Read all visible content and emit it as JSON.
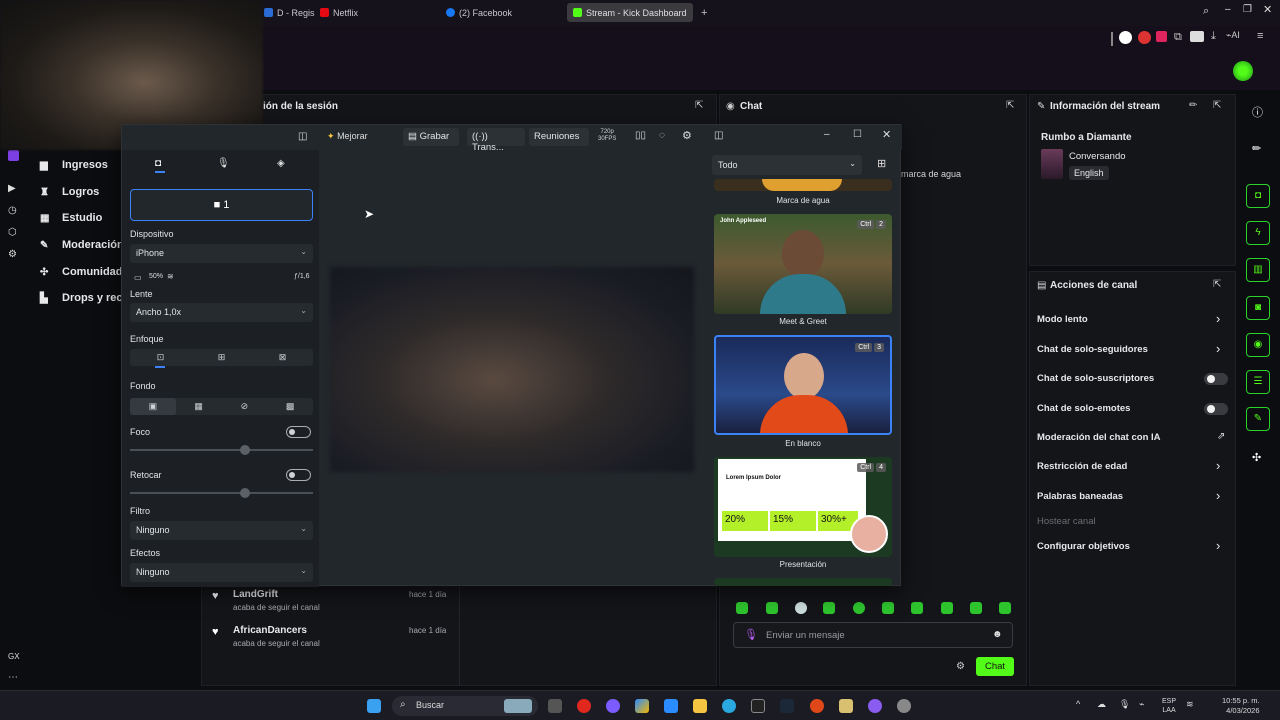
{
  "browser": {
    "tabs": [
      {
        "label": "D - Regis",
        "color": "#2b6bd6"
      },
      {
        "label": "Netflix",
        "color": "#e50914"
      },
      {
        "label": "(2) Facebook",
        "color": "#1877f2"
      },
      {
        "label": "Stream - Kick Dashboard",
        "color": "#53fc18"
      }
    ],
    "new_tab": "+",
    "ai_label": "AI"
  },
  "session_panel": {
    "title": "ión de la sesión"
  },
  "chat_panel": {
    "title": "Chat",
    "watermark_text": "marca de agua",
    "input_placeholder": "Enviar un mensaje",
    "send_label": "Chat"
  },
  "sidebar": {
    "items": [
      {
        "label": "Ingresos",
        "icon": "chart-icon"
      },
      {
        "label": "Logros",
        "icon": "trophy-icon"
      },
      {
        "label": "Estudio",
        "icon": "studio-icon"
      },
      {
        "label": "Moderación",
        "icon": "wrench-icon"
      },
      {
        "label": "Comunidad",
        "icon": "community-icon"
      },
      {
        "label": "Drops y rec",
        "icon": "drops-icon"
      }
    ],
    "gx_label": "GX"
  },
  "activity": [
    {
      "user": "LandGrift",
      "text": "acaba de seguir el canal",
      "time": "hace 1 día"
    },
    {
      "user": "AfricanDancers",
      "text": "acaba de seguir el canal",
      "time": "hace 1 día"
    }
  ],
  "camera_app": {
    "toolbar": {
      "enhance": "Mejorar",
      "record": "Grabar",
      "transmit": "Trans...",
      "meetings": "Reuniones",
      "res_top": "720p",
      "res_bottom": "30FPS"
    },
    "camera_button": "1",
    "device_label": "Dispositivo",
    "device_value": "iPhone",
    "battery": "50%",
    "aperture": "ƒ/1,6",
    "lens_label": "Lente",
    "lens_value": "Ancho 1,0x",
    "focus_label": "Enfoque",
    "background_label": "Fondo",
    "blur_label": "Foco",
    "retouch_label": "Retocar",
    "filter_label": "Filtro",
    "filter_value": "Ninguno",
    "effects_label": "Efectos",
    "effects_value": "Ninguno",
    "scene_filter": "Todo",
    "scenes": [
      {
        "caption": "Marca de agua"
      },
      {
        "caption": "Meet & Greet",
        "key": "Ctrl",
        "num": "2",
        "card_name": "John Appleseed"
      },
      {
        "caption": "En blanco",
        "key": "Ctrl",
        "num": "3"
      },
      {
        "caption": "Presentación",
        "key": "Ctrl",
        "num": "4",
        "slide_title": "Lorem Ipsum Dolor",
        "stats": [
          "20%",
          "15%",
          "30%+"
        ]
      }
    ]
  },
  "stream_info": {
    "title": "Información del stream",
    "stream_title": "Rumbo a Diamante",
    "category": "Conversando",
    "language": "English"
  },
  "channel_actions": {
    "title": "Acciones de canal",
    "items": [
      {
        "label": "Modo lento",
        "control": "arrow"
      },
      {
        "label": "Chat de solo-seguidores",
        "control": "arrow"
      },
      {
        "label": "Chat de solo-suscriptores",
        "control": "toggle"
      },
      {
        "label": "Chat de solo-emotes",
        "control": "toggle"
      },
      {
        "label": "Moderación del chat con IA",
        "control": "external"
      },
      {
        "label": "Restricción de edad",
        "control": "arrow"
      },
      {
        "label": "Palabras baneadas",
        "control": "arrow"
      },
      {
        "label": "Hostear canal",
        "control": "none"
      },
      {
        "label": "Configurar objetivos",
        "control": "arrow"
      }
    ]
  },
  "taskbar": {
    "search": "Buscar",
    "lang_top": "ESP",
    "lang_bottom": "LAA",
    "time": "10:55 p. m.",
    "date": "4/03/2026"
  },
  "colors": {
    "kick_green": "#53fc18",
    "accent_blue": "#3b82f6"
  }
}
